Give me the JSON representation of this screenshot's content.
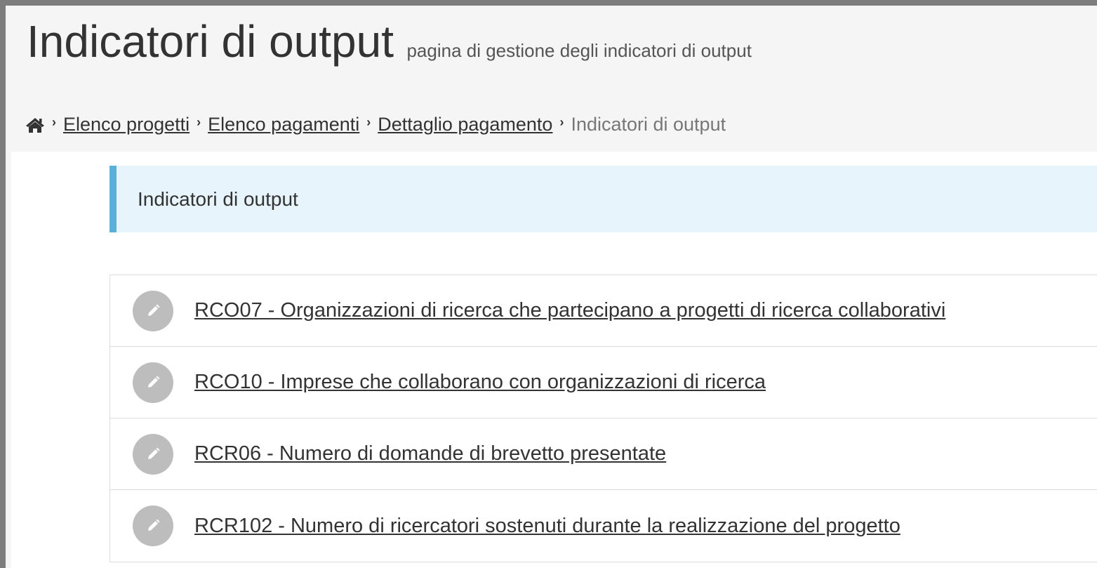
{
  "header": {
    "title": "Indicatori di output",
    "subtitle": "pagina di gestione degli indicatori di output"
  },
  "breadcrumb": {
    "home_icon": "home-icon",
    "items": [
      {
        "label": "Elenco progetti",
        "link": true
      },
      {
        "label": "Elenco pagamenti",
        "link": true
      },
      {
        "label": "Dettaglio pagamento",
        "link": true
      },
      {
        "label": "Indicatori di output",
        "link": false
      }
    ]
  },
  "info_box": {
    "text": "Indicatori di output"
  },
  "indicators": [
    {
      "label": "RCO07 - Organizzazioni di ricerca che partecipano a progetti di ricerca collaborativi",
      "icon": "pencil-icon"
    },
    {
      "label": "RCO10 - Imprese che collaborano con organizzazioni di ricerca",
      "icon": "pencil-icon"
    },
    {
      "label": "RCR06 - Numero di domande di brevetto presentate",
      "icon": "pencil-icon"
    },
    {
      "label": "RCR102 - Numero di ricercatori sostenuti durante la realizzazione del progetto",
      "icon": "pencil-icon"
    }
  ],
  "colors": {
    "accent": "#5bb0d8",
    "info_bg": "#e8f4fb",
    "icon_bg": "#bdbdbd"
  }
}
